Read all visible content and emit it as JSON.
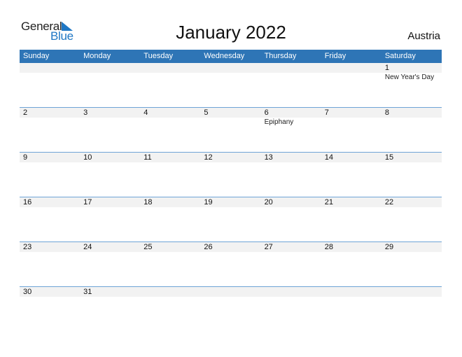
{
  "logo": {
    "general": "General",
    "blue": "Blue"
  },
  "title": "January 2022",
  "country": "Austria",
  "colors": {
    "header": "#2e75b6",
    "accent": "#1f77c4",
    "strip": "#f2f2f2",
    "week_border": "#6ea4d6"
  },
  "weekdays": [
    "Sunday",
    "Monday",
    "Tuesday",
    "Wednesday",
    "Thursday",
    "Friday",
    "Saturday"
  ],
  "weeks": [
    {
      "days": [
        "",
        "",
        "",
        "",
        "",
        "",
        "1"
      ],
      "events": [
        "",
        "",
        "",
        "",
        "",
        "",
        "New Year's Day"
      ]
    },
    {
      "days": [
        "2",
        "3",
        "4",
        "5",
        "6",
        "7",
        "8"
      ],
      "events": [
        "",
        "",
        "",
        "",
        "Epiphany",
        "",
        ""
      ]
    },
    {
      "days": [
        "9",
        "10",
        "11",
        "12",
        "13",
        "14",
        "15"
      ],
      "events": [
        "",
        "",
        "",
        "",
        "",
        "",
        ""
      ]
    },
    {
      "days": [
        "16",
        "17",
        "18",
        "19",
        "20",
        "21",
        "22"
      ],
      "events": [
        "",
        "",
        "",
        "",
        "",
        "",
        ""
      ]
    },
    {
      "days": [
        "23",
        "24",
        "25",
        "26",
        "27",
        "28",
        "29"
      ],
      "events": [
        "",
        "",
        "",
        "",
        "",
        "",
        ""
      ]
    },
    {
      "days": [
        "30",
        "31",
        "",
        "",
        "",
        "",
        ""
      ],
      "events": [
        "",
        "",
        "",
        "",
        "",
        "",
        ""
      ]
    }
  ]
}
